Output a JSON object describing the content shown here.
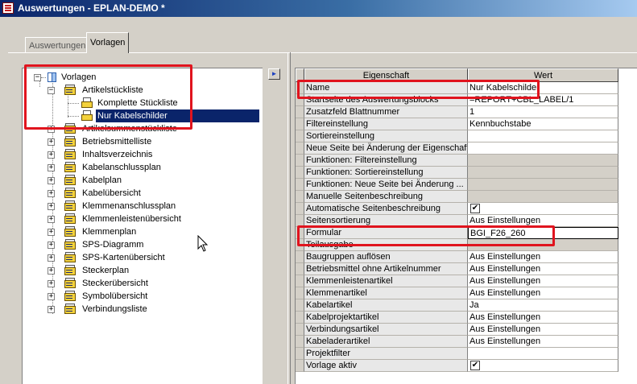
{
  "window": {
    "title": "Auswertungen - EPLAN-DEMO *"
  },
  "tabs": [
    {
      "label": "Auswertungen",
      "active": false
    },
    {
      "label": "Vorlagen",
      "active": true
    }
  ],
  "tree": {
    "root": {
      "label": "Vorlagen",
      "icon": "book-icon"
    },
    "artikel": {
      "label": "Artikelstückliste"
    },
    "children": [
      {
        "label": "Komplette Stückliste"
      },
      {
        "label": "Nur Kabelschilder",
        "selected": true
      }
    ],
    "items": [
      {
        "label": "Artikelsummenstückliste"
      },
      {
        "label": "Betriebsmittelliste"
      },
      {
        "label": "Inhaltsverzeichnis"
      },
      {
        "label": "Kabelanschlussplan"
      },
      {
        "label": "Kabelplan"
      },
      {
        "label": "Kabelübersicht"
      },
      {
        "label": "Klemmenanschlussplan"
      },
      {
        "label": "Klemmenleistenübersicht"
      },
      {
        "label": "Klemmenplan"
      },
      {
        "label": "SPS-Diagramm"
      },
      {
        "label": "SPS-Kartenübersicht"
      },
      {
        "label": "Steckerplan"
      },
      {
        "label": "Steckerübersicht"
      },
      {
        "label": "Symbolübersicht"
      },
      {
        "label": "Verbindungsliste"
      }
    ]
  },
  "arrow_button": "►",
  "grid": {
    "headers": {
      "property": "Eigenschaft",
      "value": "Wert"
    },
    "rows": [
      {
        "property": "Name",
        "value": "Nur Kabelschilder"
      },
      {
        "property": "Startseite des Auswertungsblocks",
        "value": "=REPORT+CBL_LABEL/1"
      },
      {
        "property": "Zusatzfeld Blattnummer",
        "value": "1"
      },
      {
        "property": "Filtereinstellung",
        "value": "Kennbuchstabe"
      },
      {
        "property": "Sortiereinstellung",
        "value": ""
      },
      {
        "property": "Neue Seite bei Änderung der Eigenschaft",
        "value": ""
      },
      {
        "property": "Funktionen: Filtereinstellung",
        "value": "",
        "gray": true
      },
      {
        "property": "Funktionen: Sortiereinstellung",
        "value": "",
        "gray": true
      },
      {
        "property": "Funktionen: Neue Seite bei Änderung ...",
        "value": "",
        "gray": true
      },
      {
        "property": "Manuelle Seitenbeschreibung",
        "value": "",
        "gray": true
      },
      {
        "property": "Automatische Seitenbeschreibung",
        "value": "",
        "checkbox": true
      },
      {
        "property": "Seitensortierung",
        "value": "Aus Einstellungen"
      },
      {
        "property": "Formular",
        "value": "BGI_F26_260",
        "editing": true
      },
      {
        "property": "Teilausgabe",
        "value": "",
        "gray": true
      },
      {
        "property": "Baugruppen auflösen",
        "value": "Aus Einstellungen"
      },
      {
        "property": "Betriebsmittel ohne Artikelnummer",
        "value": "Aus Einstellungen"
      },
      {
        "property": "Klemmenleistenartikel",
        "value": "Aus Einstellungen"
      },
      {
        "property": "Klemmenartikel",
        "value": "Aus Einstellungen"
      },
      {
        "property": "Kabelartikel",
        "value": "Ja"
      },
      {
        "property": "Kabelprojektartikel",
        "value": "Aus Einstellungen"
      },
      {
        "property": "Verbindungsartikel",
        "value": "Aus Einstellungen"
      },
      {
        "property": "Kabeladerartikel",
        "value": "Aus Einstellungen"
      },
      {
        "property": "Projektfilter",
        "value": ""
      },
      {
        "property": "Vorlage aktiv",
        "value": "",
        "checkbox": true
      }
    ]
  },
  "colors": {
    "title_start": "#0a246a",
    "selection": "#0a246a",
    "highlight_box": "#e0141e"
  }
}
